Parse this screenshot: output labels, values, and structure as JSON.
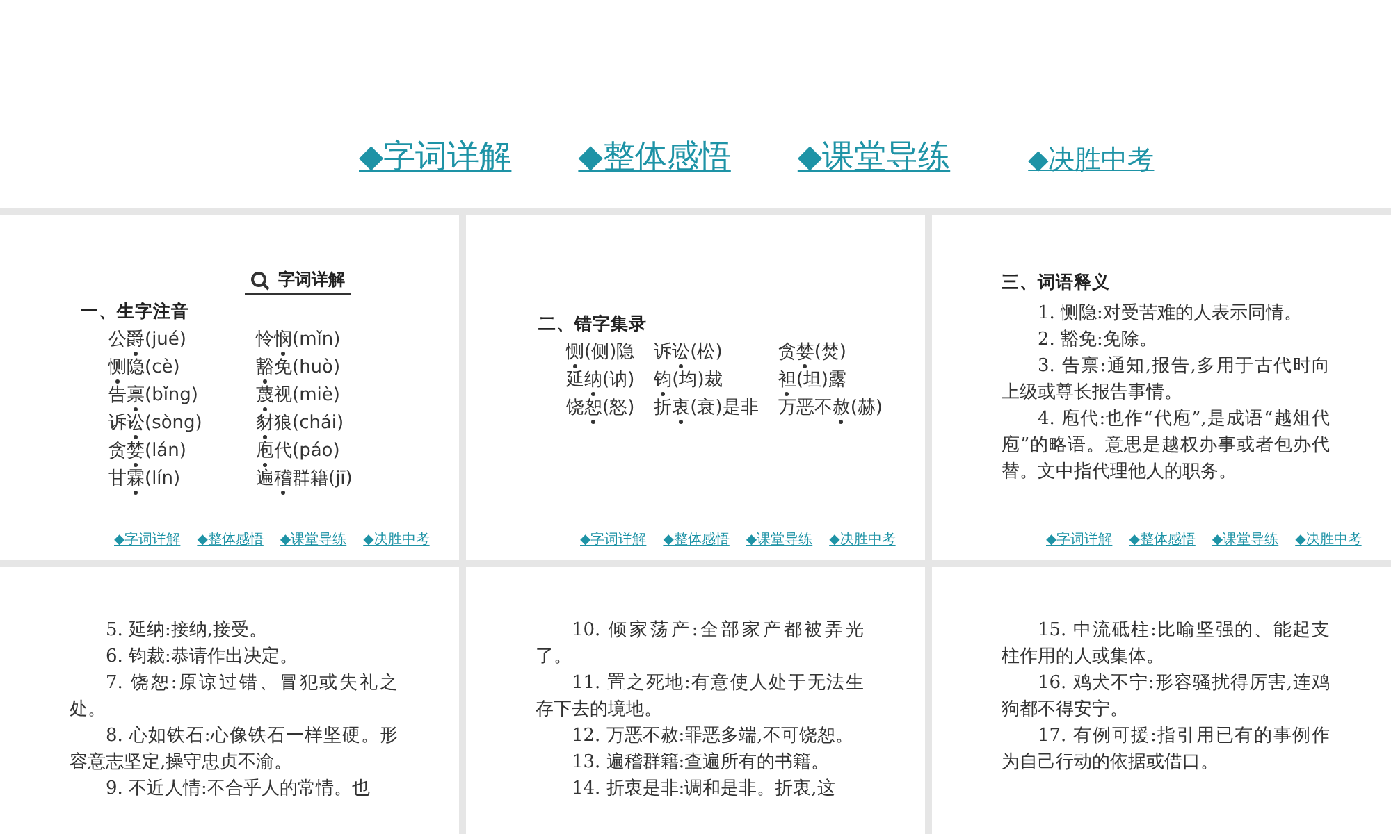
{
  "nav": [
    {
      "label": "◆字词详解",
      "kind": "major"
    },
    {
      "label": "◆整体感悟",
      "kind": "major"
    },
    {
      "label": "◆课堂导练",
      "kind": "major"
    },
    {
      "label": "◆决胜中考",
      "kind": "minor"
    }
  ],
  "slides": [
    {
      "kind": "pinyin",
      "badge": "字词详解",
      "heading": "一、生字注音",
      "items": [
        {
          "pre": "公",
          "dot": "爵",
          "post": "(jué)"
        },
        {
          "pre": "怜",
          "dot": "悯",
          "post": "(mǐn)"
        },
        {
          "dot": "恻",
          "post": "隐(cè)"
        },
        {
          "dot": "豁",
          "post": "免(huò)"
        },
        {
          "pre": "告",
          "dot": "禀",
          "post": "(bǐng)"
        },
        {
          "dot": "蔑",
          "post": "视(miè)"
        },
        {
          "pre": "诉",
          "dot": "讼",
          "post": "(sòng)"
        },
        {
          "dot": "豺",
          "post": "狼(chái)"
        },
        {
          "pre": "贪",
          "dot": "婪",
          "post": "(lán)"
        },
        {
          "dot": "庖",
          "post": "代(páo)"
        },
        {
          "pre": "甘",
          "dot": "霖",
          "post": "(lín)"
        },
        {
          "pre": "遍",
          "dot": "稽",
          "post": "群籍(jī)"
        }
      ],
      "footer": [
        "◆字词详解",
        "◆整体感悟",
        "◆课堂导练",
        "◆决胜中考"
      ]
    },
    {
      "kind": "errata",
      "heading": "二、错字集录",
      "items": [
        {
          "dot": "恻",
          "post": "(侧)隐"
        },
        {
          "pre": "诉",
          "dot": "讼",
          "post": "(松)"
        },
        {
          "pre": "贪",
          "dot": "婪",
          "post": "(焚)"
        },
        {
          "pre": "延",
          "dot": "纳",
          "post": "(讷)"
        },
        {
          "dot": "钧",
          "post": "(均)裁"
        },
        {
          "dot": "袒",
          "post": "(坦)露"
        },
        {
          "pre": "饶",
          "dot": "恕",
          "post": "(怒)"
        },
        {
          "pre": "折",
          "dot": "衷",
          "post": "(衰)是非"
        },
        {
          "pre": "万恶不",
          "dot": "赦",
          "post": "(赫)"
        }
      ],
      "footer": [
        "◆字词详解",
        "◆整体感悟",
        "◆课堂导练",
        "◆决胜中考"
      ]
    },
    {
      "kind": "glossary",
      "heading": "三、词语释义",
      "paragraphs": [
        "1. 恻隐:对受苦难的人表示同情。",
        "2. 豁免:免除。",
        "3. 告禀:通知,报告,多用于古代时向上级或尊长报告事情。",
        "4. 庖代:也作“代庖”,是成语“越俎代庖”的略语。意思是越权办事或者包办代替。文中指代理他人的职务。"
      ],
      "footer": [
        "◆字词详解",
        "◆整体感悟",
        "◆课堂导练",
        "◆决胜中考"
      ]
    },
    {
      "kind": "glossary",
      "paragraphs": [
        "5. 延纳:接纳,接受。",
        "6. 钧裁:恭请作出决定。",
        "7. 饶恕:原谅过错、冒犯或失礼之处。",
        "8. 心如铁石:心像铁石一样坚硬。形容意志坚定,操守忠贞不渝。",
        "9. 不近人情:不合乎人的常情。也"
      ]
    },
    {
      "kind": "glossary",
      "paragraphs": [
        "10. 倾家荡产:全部家产都被弄光了。",
        "11. 置之死地:有意使人处于无法生存下去的境地。",
        "12. 万恶不赦:罪恶多端,不可饶恕。",
        "13. 遍稽群籍:查遍所有的书籍。",
        "14. 折衷是非:调和是非。折衷,这"
      ]
    },
    {
      "kind": "glossary",
      "paragraphs": [
        "15. 中流砥柱:比喻坚强的、能起支柱作用的人或集体。",
        "16. 鸡犬不宁:形容骚扰得厉害,连鸡狗都不得安宁。",
        "17. 有例可援:指引用已有的事例作为自己行动的依据或借口。"
      ]
    }
  ]
}
